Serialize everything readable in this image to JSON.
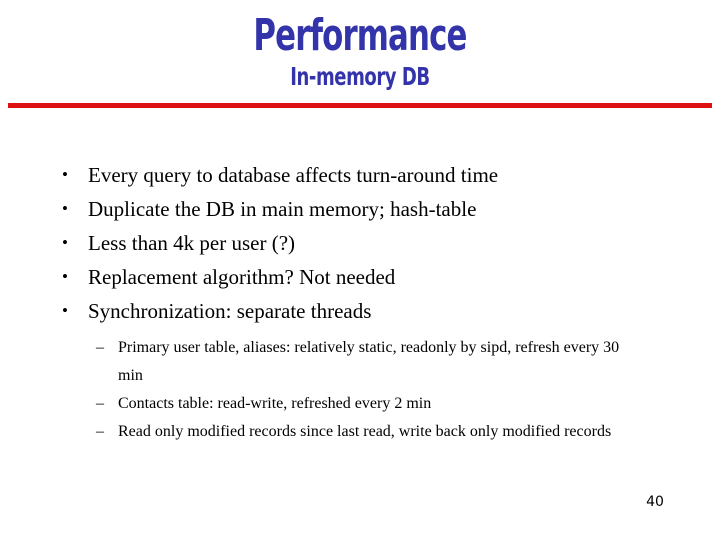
{
  "slide": {
    "title": "Performance",
    "subtitle": "In-memory DB",
    "page_number": "40",
    "title_color": "#3333AA",
    "divider_color": "#DD1111",
    "background_color": "#FFFFFF",
    "text_color": "#000000",
    "bullet_marker": "•",
    "sub_bullet_marker": "–",
    "bullets": [
      {
        "text": "Every query to database affects turn-around time"
      },
      {
        "text": "Duplicate the DB in main memory; hash-table"
      },
      {
        "text": "Less than 4k per user (?)"
      },
      {
        "text": "Replacement algorithm? Not needed"
      },
      {
        "text": "Synchronization: separate threads"
      }
    ],
    "sub_bullets": [
      {
        "text": "Primary user table, aliases: relatively static, readonly by sipd, refresh every 30 min"
      },
      {
        "text": "Contacts table: read-write, refreshed every 2 min"
      },
      {
        "text": "Read only modified records since last read, write back only modified records"
      }
    ]
  }
}
